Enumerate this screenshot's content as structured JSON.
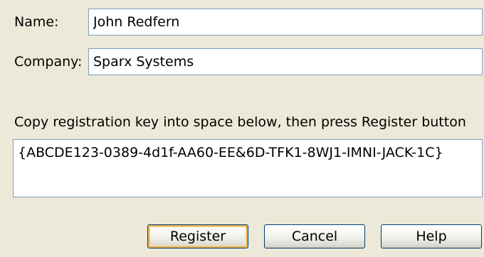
{
  "form": {
    "name_label": "Name:",
    "name_value": "John Redfern",
    "company_label": "Company:",
    "company_value": "Sparx Systems",
    "instruction": "Copy registration key into space below, then press Register button",
    "key_value": "{ABCDE123-0389-4d1f-AA60-EE&6D-TFK1-8WJ1-IMNI-JACK-1C}"
  },
  "buttons": {
    "register_label": "Register",
    "cancel_label": "Cancel",
    "help_label": "Help"
  },
  "colors": {
    "dialog_background": "#ECE9D8",
    "field_border": "#7F9DB9",
    "button_border": "#003C74",
    "default_button_highlight": "#E8B35A"
  }
}
